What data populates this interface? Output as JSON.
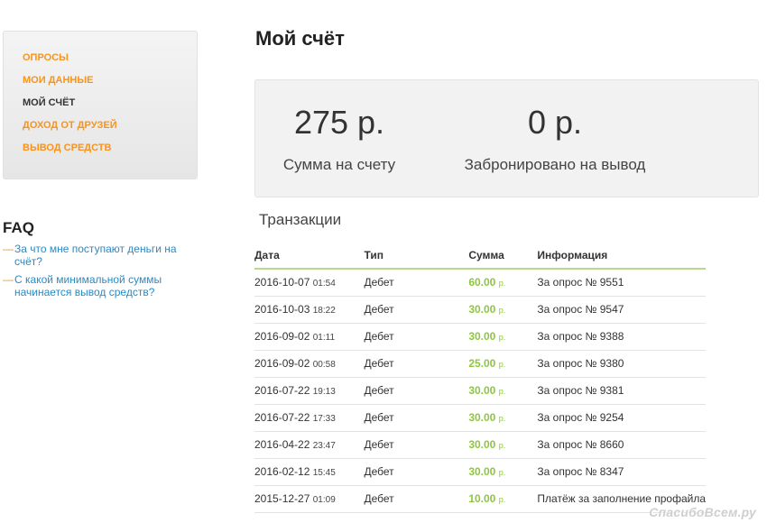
{
  "nav": {
    "items": [
      {
        "label": "ОПРОСЫ",
        "active": false
      },
      {
        "label": "МОИ ДАННЫЕ",
        "active": false
      },
      {
        "label": "МОЙ СЧЁТ",
        "active": true
      },
      {
        "label": "ДОХОД ОТ ДРУЗЕЙ",
        "active": false
      },
      {
        "label": "ВЫВОД СРЕДСТВ",
        "active": false
      }
    ]
  },
  "faq": {
    "title": "FAQ",
    "dash": "—",
    "items": [
      {
        "text": "За что мне поступают деньги на счёт?"
      },
      {
        "text": "С какой минимальной суммы начинается вывод средств?"
      }
    ]
  },
  "page": {
    "title": "Мой счёт"
  },
  "balance": {
    "account": {
      "value": "275 р.",
      "label": "Сумма на счету"
    },
    "reserved": {
      "value": "0 р.",
      "label": "Забронировано на вывод"
    }
  },
  "transactions": {
    "title": "Транзакции",
    "headers": {
      "date": "Дата",
      "type": "Тип",
      "sum": "Сумма",
      "info": "Информация"
    },
    "rows": [
      {
        "date": "2016-10-07",
        "time": "01:54",
        "type": "Дебет",
        "amount": "60.00",
        "currency": "р.",
        "info": "За опрос № 9551"
      },
      {
        "date": "2016-10-03",
        "time": "18:22",
        "type": "Дебет",
        "amount": "30.00",
        "currency": "р.",
        "info": "За опрос № 9547"
      },
      {
        "date": "2016-09-02",
        "time": "01:11",
        "type": "Дебет",
        "amount": "30.00",
        "currency": "р.",
        "info": "За опрос № 9388"
      },
      {
        "date": "2016-09-02",
        "time": "00:58",
        "type": "Дебет",
        "amount": "25.00",
        "currency": "р.",
        "info": "За опрос № 9380"
      },
      {
        "date": "2016-07-22",
        "time": "19:13",
        "type": "Дебет",
        "amount": "30.00",
        "currency": "р.",
        "info": "За опрос № 9381"
      },
      {
        "date": "2016-07-22",
        "time": "17:33",
        "type": "Дебет",
        "amount": "30.00",
        "currency": "р.",
        "info": "За опрос № 9254"
      },
      {
        "date": "2016-04-22",
        "time": "23:47",
        "type": "Дебет",
        "amount": "30.00",
        "currency": "р.",
        "info": "За опрос № 8660"
      },
      {
        "date": "2016-02-12",
        "time": "15:45",
        "type": "Дебет",
        "amount": "30.00",
        "currency": "р.",
        "info": "За опрос № 8347"
      },
      {
        "date": "2015-12-27",
        "time": "01:09",
        "type": "Дебет",
        "amount": "10.00",
        "currency": "р.",
        "info": "Платёж за заполнение профайла"
      }
    ]
  },
  "watermark": {
    "text": "СпасибоВсем.ру"
  },
  "colors": {
    "accent": "#f7941d",
    "link": "#2a8ac5",
    "amount": "#8dc63f",
    "table_header_border": "#b8d98a"
  }
}
